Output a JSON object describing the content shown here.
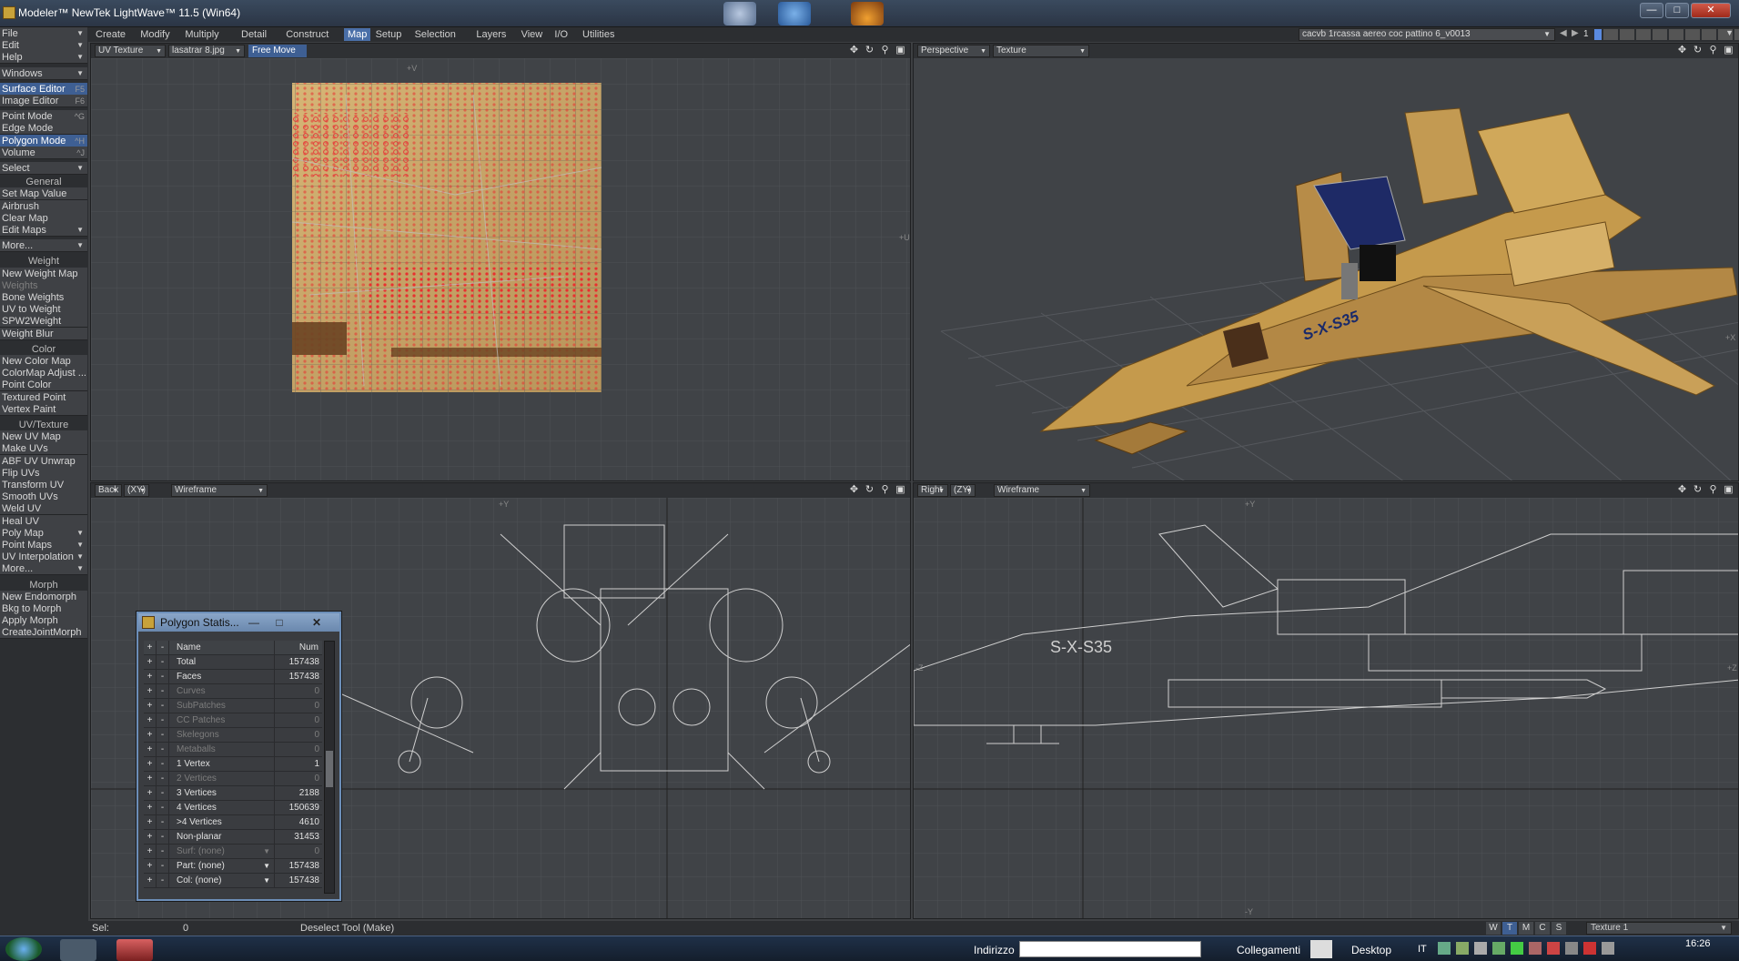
{
  "window": {
    "title": "Modeler™ NewTek LightWave™ 11.5 (Win64)"
  },
  "menu_tabs": [
    "Create",
    "Modify",
    "Multiply",
    "Detail",
    "Construct",
    "Map",
    "Setup",
    "Selection",
    "Layers",
    "View",
    "I/O",
    "Utilities"
  ],
  "active_tab": "Map",
  "scene_selector": "cacvb 1rcassa aereo  coc pattino 6_v0013",
  "layer_number": "1",
  "sidebar": {
    "top": [
      {
        "label": "File",
        "drop": true
      },
      {
        "label": "Edit",
        "drop": true
      },
      {
        "label": "Help",
        "drop": true
      },
      {
        "label": "Windows",
        "drop": true
      }
    ],
    "editors": [
      {
        "label": "Surface Editor",
        "shortcut": "F5",
        "selected": true
      },
      {
        "label": "Image Editor",
        "shortcut": "F6"
      }
    ],
    "modes": [
      {
        "label": "Point Mode",
        "shortcut": "^G"
      },
      {
        "label": "Edge Mode",
        "shortcut": ""
      },
      {
        "label": "Polygon Mode",
        "shortcut": "^H",
        "selected": true
      },
      {
        "label": "Volume",
        "shortcut": "^J"
      }
    ],
    "select": "Select",
    "general_heading": "General",
    "general": [
      "Set Map Value",
      "Airbrush",
      "Clear Map",
      "Edit Maps",
      "More..."
    ],
    "weight_heading": "Weight",
    "weight": [
      "New Weight Map",
      "Weights",
      "Bone Weights",
      "UV to Weight",
      "SPW2Weight",
      "Weight Blur"
    ],
    "color_heading": "Color",
    "color": [
      "New Color Map",
      "ColorMap Adjust ...",
      "Point Color",
      "Textured Point",
      "Vertex Paint"
    ],
    "uv_heading": "UV/Texture",
    "uv": [
      "New UV Map",
      "Make UVs",
      "ABF UV Unwrap",
      "Flip UVs",
      "Transform UV",
      "Smooth UVs",
      "Weld UV",
      "Heal UV",
      "Poly Map",
      "Point Maps",
      "UV Interpolation",
      "More..."
    ],
    "morph_heading": "Morph",
    "morph": [
      "New Endomorph",
      "Bkg to Morph",
      "Apply Morph",
      "CreateJointMorph"
    ]
  },
  "viewports": {
    "top_left": {
      "mode": "UV Texture",
      "image": "lasatrar 8.jpg",
      "tool": "Free Move"
    },
    "top_right": {
      "view": "Perspective",
      "shading": "Texture",
      "model_label": "S-X-S35"
    },
    "bottom_left": {
      "view": "Back",
      "axis": "(XY)",
      "shading": "Wireframe"
    },
    "bottom_right": {
      "view": "Right",
      "axis": "(ZY)",
      "shading": "Wireframe",
      "model_label": "S-X-S35"
    }
  },
  "axis_markers": {
    "plus_v": "+V",
    "plus_u": "+U",
    "plus_x": "+X",
    "plus_y": "+Y",
    "minus_y": "-Y",
    "minus_z": "-Z",
    "plus_z": "+Z"
  },
  "polygon_statistics": {
    "title": "Polygon Statis...",
    "header": {
      "name": "Name",
      "num": "Num"
    },
    "rows": [
      {
        "name": "Total",
        "num": "157438",
        "dim": false
      },
      {
        "name": "Faces",
        "num": "157438",
        "dim": false
      },
      {
        "name": "Curves",
        "num": "0",
        "dim": true
      },
      {
        "name": "SubPatches",
        "num": "0",
        "dim": true
      },
      {
        "name": "CC Patches",
        "num": "0",
        "dim": true
      },
      {
        "name": "Skelegons",
        "num": "0",
        "dim": true
      },
      {
        "name": "Metaballs",
        "num": "0",
        "dim": true
      },
      {
        "name": "1 Vertex",
        "num": "1",
        "dim": false
      },
      {
        "name": "2 Vertices",
        "num": "0",
        "dim": true
      },
      {
        "name": "3 Vertices",
        "num": "2188",
        "dim": false
      },
      {
        "name": "4 Vertices",
        "num": "150639",
        "dim": false
      },
      {
        "name": ">4 Vertices",
        "num": "4610",
        "dim": false
      },
      {
        "name": "Non-planar",
        "num": "31453",
        "dim": false
      },
      {
        "name": "Surf: (none)",
        "num": "0",
        "dim": true,
        "drop": true
      },
      {
        "name": "Part: (none)",
        "num": "157438",
        "dim": false,
        "drop": true
      },
      {
        "name": "Col: (none)",
        "num": "157438",
        "dim": false,
        "drop": true
      }
    ]
  },
  "status": {
    "sel_label": "Sel:",
    "sel_value": "0",
    "message": "Deselect Tool (Make)",
    "toggles": [
      "W",
      "T",
      "M",
      "C",
      "S"
    ],
    "active_toggle": "T",
    "texture": "Texture 1"
  },
  "taskbar": {
    "address_label": "Indirizzo",
    "links_label": "Collegamenti",
    "desktop_label": "Desktop",
    "lang": "IT",
    "time": "16:26"
  }
}
